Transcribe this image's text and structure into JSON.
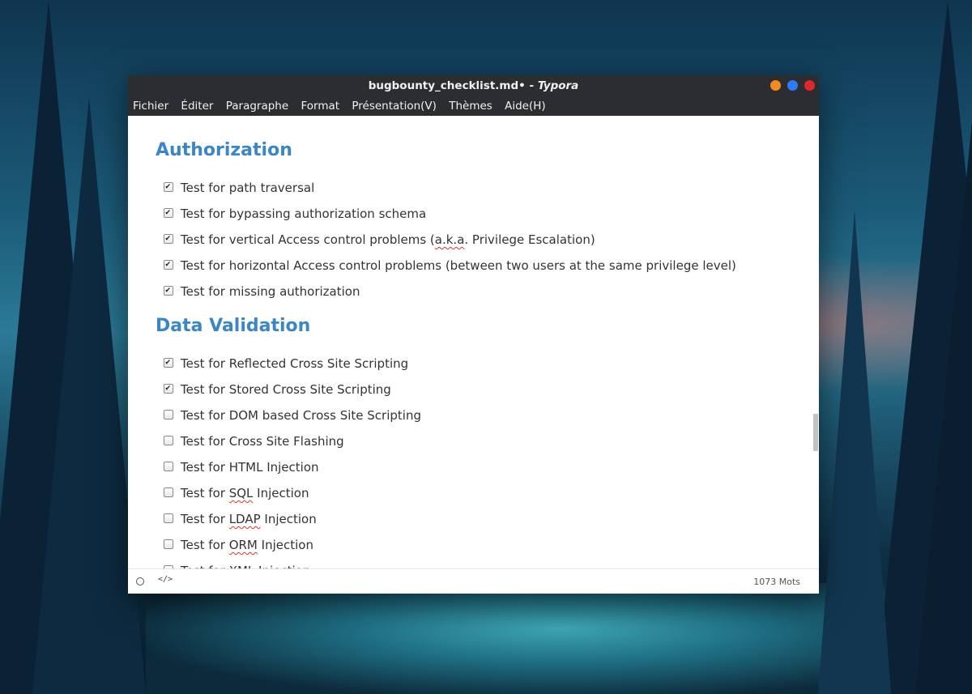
{
  "window": {
    "title_file": "bugbounty_checklist.md•",
    "title_sep": " - ",
    "title_app": "Typora"
  },
  "menu": [
    "Fichier",
    "Éditer",
    "Paragraphe",
    "Format",
    "Présentation(V)",
    "Thèmes",
    "Aide(H)"
  ],
  "sections": [
    {
      "heading": "Authorization",
      "items": [
        {
          "checked": true,
          "parts": [
            {
              "t": "Test for path traversal"
            }
          ]
        },
        {
          "checked": true,
          "parts": [
            {
              "t": "Test for bypassing authorization schema"
            }
          ]
        },
        {
          "checked": true,
          "parts": [
            {
              "t": "Test for vertical Access control problems ("
            },
            {
              "t": "a.k.a",
              "sq": true
            },
            {
              "t": ". Privilege Escalation)"
            }
          ]
        },
        {
          "checked": true,
          "parts": [
            {
              "t": "Test for horizontal Access control problems (between two users at the same privilege level)"
            }
          ]
        },
        {
          "checked": true,
          "parts": [
            {
              "t": "Test for missing authorization"
            }
          ]
        }
      ]
    },
    {
      "heading": "Data Validation",
      "items": [
        {
          "checked": true,
          "parts": [
            {
              "t": "Test for Reflected Cross Site Scripting"
            }
          ]
        },
        {
          "checked": true,
          "parts": [
            {
              "t": "Test for Stored Cross Site Scripting"
            }
          ]
        },
        {
          "checked": false,
          "parts": [
            {
              "t": "Test for DOM based Cross Site Scripting"
            }
          ]
        },
        {
          "checked": false,
          "parts": [
            {
              "t": "Test for Cross Site Flashing"
            }
          ]
        },
        {
          "checked": false,
          "parts": [
            {
              "t": "Test for HTML Injection"
            }
          ]
        },
        {
          "checked": false,
          "parts": [
            {
              "t": "Test for "
            },
            {
              "t": "SQL",
              "sq": true
            },
            {
              "t": " Injection"
            }
          ]
        },
        {
          "checked": false,
          "parts": [
            {
              "t": "Test for "
            },
            {
              "t": "LDAP",
              "sq": true
            },
            {
              "t": " Injection"
            }
          ]
        },
        {
          "checked": false,
          "parts": [
            {
              "t": "Test for "
            },
            {
              "t": "ORM",
              "sq": true
            },
            {
              "t": " Injection"
            }
          ]
        },
        {
          "checked": false,
          "parts": [
            {
              "t": "Test for XML Injection"
            }
          ]
        }
      ]
    }
  ],
  "status": {
    "source_code_icon": "</>",
    "word_count": "1073 Mots"
  },
  "colors": {
    "heading": "#3a86c8",
    "titlebar": "#2b2d31",
    "min": "#f58a1f",
    "max": "#2f7bf5",
    "close": "#e0262b"
  }
}
